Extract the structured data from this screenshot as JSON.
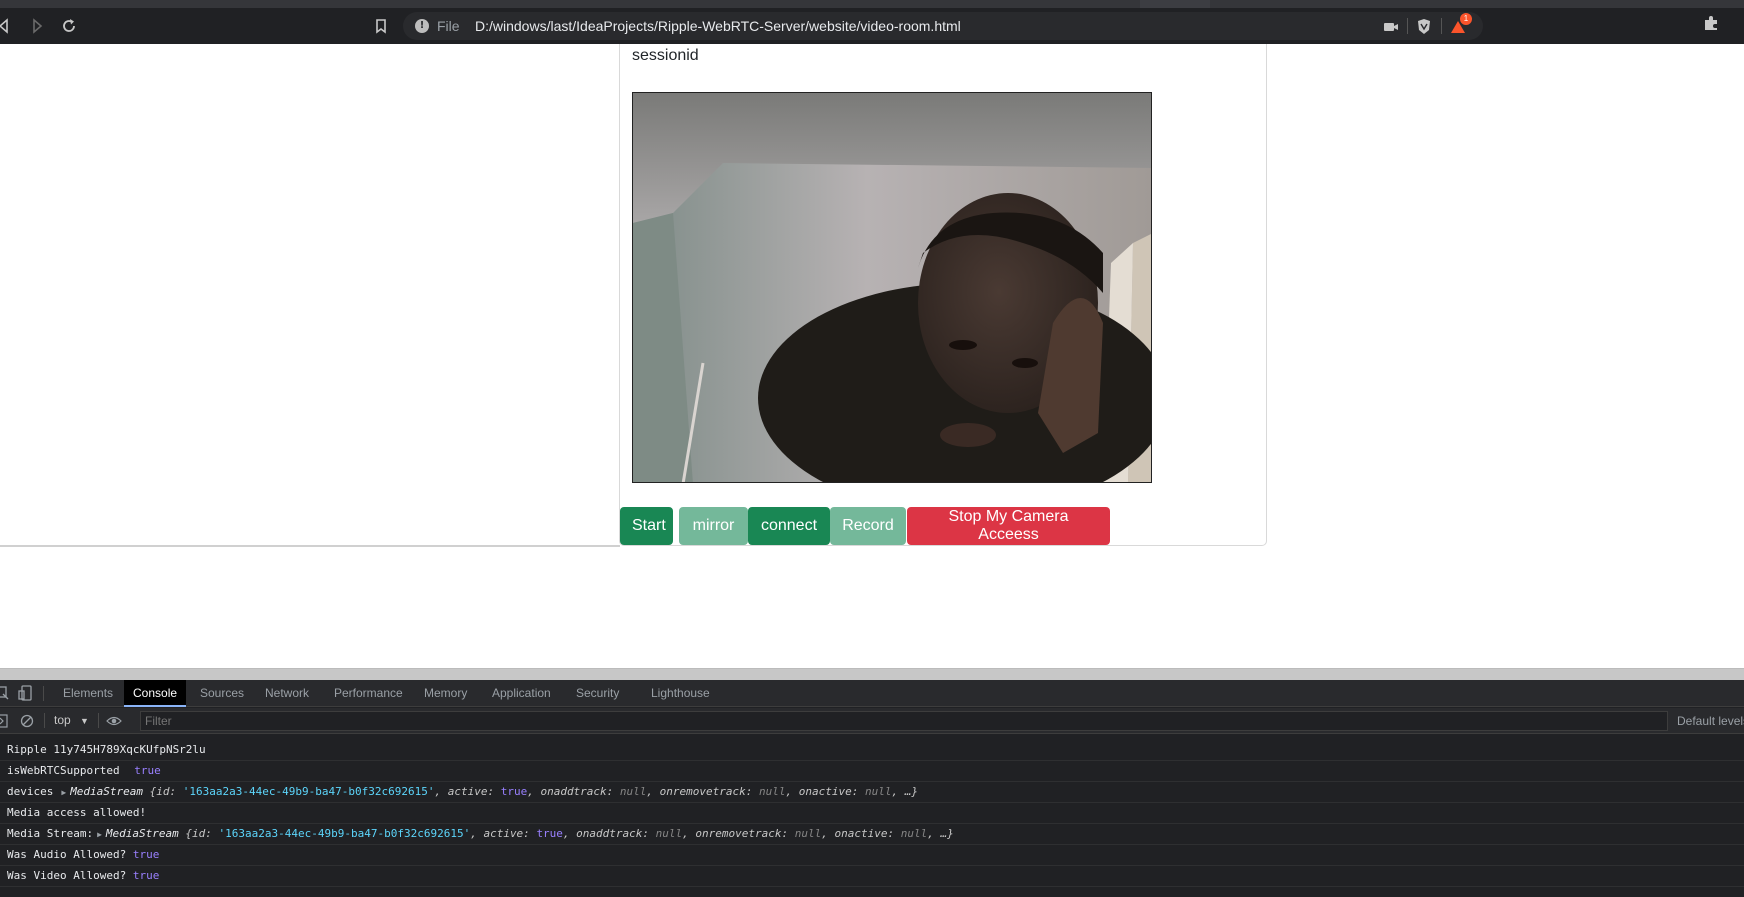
{
  "browser": {
    "back_icon": "back-arrow-icon",
    "forward_icon": "forward-arrow-icon",
    "reload_icon": "reload-icon",
    "bookmark_icon": "bookmark-icon",
    "info_icon": "info-icon",
    "scheme_label": "File",
    "url": "D:/windows/last/IdeaProjects/Ripple-WebRTC-Server/website/video-room.html",
    "camera_icon": "camera-icon",
    "brave_shield_icon": "brave-shield-icon",
    "rewards_icon": "brave-rewards-icon",
    "rewards_badge": "1",
    "extensions_icon": "puzzle-piece-icon"
  },
  "page": {
    "session_label": "sessionid",
    "video_alt": "camera video feed",
    "buttons": {
      "start": "Start",
      "mirror": "mirror",
      "connect": "connect",
      "record": "Record",
      "stop_camera": "Stop My Camera Acceess"
    },
    "colors": {
      "green": "#198754",
      "green_faded": "#74b89a",
      "red": "#dc3545"
    }
  },
  "devtools": {
    "tabs": [
      "Elements",
      "Console",
      "Sources",
      "Network",
      "Performance",
      "Memory",
      "Application",
      "Security",
      "Lighthouse"
    ],
    "active_tab": "Console",
    "context": "top",
    "filter_placeholder": "Filter",
    "levels": "Default levels",
    "console": {
      "line1": "Ripple 11y745H789XqcKUfpNSr2lu",
      "line2_label": "isWebRTCSupported",
      "line2_value": "true",
      "line3_label": "devices",
      "line4": "Media access allowed!",
      "line5_label": "Media Stream:",
      "media_stream_class": "MediaStream",
      "stream_id": "'163aa2a3-44ec-49b9-ba47-b0f32c692615'",
      "true_value": "true",
      "null_value": "null",
      "line6_label": "Was Audio Allowed?",
      "line6_value": "true",
      "line7_label": "Was Video Allowed?",
      "line7_value": "true"
    }
  }
}
